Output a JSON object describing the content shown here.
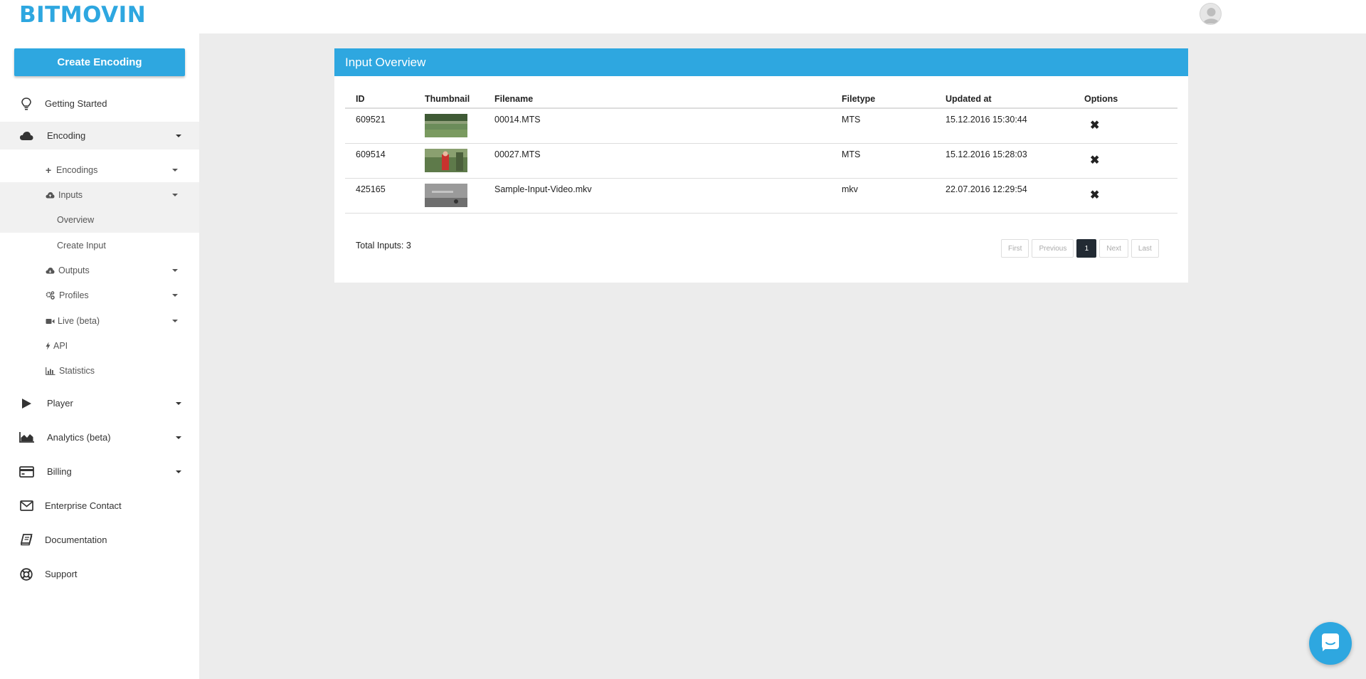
{
  "header": {
    "logo": "BITMOVIN"
  },
  "sidebar": {
    "create_button": "Create Encoding",
    "items": {
      "getting_started": "Getting Started",
      "encoding": "Encoding",
      "encodings": "Encodings",
      "inputs": "Inputs",
      "overview": "Overview",
      "create_input": "Create Input",
      "outputs": "Outputs",
      "profiles": "Profiles",
      "live": "Live (beta)",
      "api": "API",
      "statistics": "Statistics",
      "player": "Player",
      "analytics": "Analytics (beta)",
      "billing": "Billing",
      "enterprise_contact": "Enterprise Contact",
      "documentation": "Documentation",
      "support": "Support"
    }
  },
  "main": {
    "title": "Input Overview",
    "columns": [
      "ID",
      "Thumbnail",
      "Filename",
      "Filetype",
      "Updated at",
      "Options"
    ],
    "rows": [
      {
        "id": "609521",
        "thumbnail": "green-field-thumbnail",
        "filename": "00014.MTS",
        "filetype": "MTS",
        "updated": "15.12.2016 15:30:44",
        "option": "✖"
      },
      {
        "id": "609514",
        "thumbnail": "red-figure-thumbnail",
        "filename": "00027.MTS",
        "filetype": "MTS",
        "updated": "15.12.2016 15:28:03",
        "option": "✖"
      },
      {
        "id": "425165",
        "thumbnail": "grey-scene-thumbnail",
        "filename": "Sample-Input-Video.mkv",
        "filetype": "mkv",
        "updated": "22.07.2016 12:29:54",
        "option": "✖"
      }
    ],
    "total": "Total Inputs: 3",
    "pagination": {
      "first": "First",
      "previous": "Previous",
      "current": "1",
      "next": "Next",
      "last": "Last"
    }
  },
  "colors": {
    "accent": "#2ea7e0",
    "active_page": "#222a33",
    "background": "#ececec"
  }
}
